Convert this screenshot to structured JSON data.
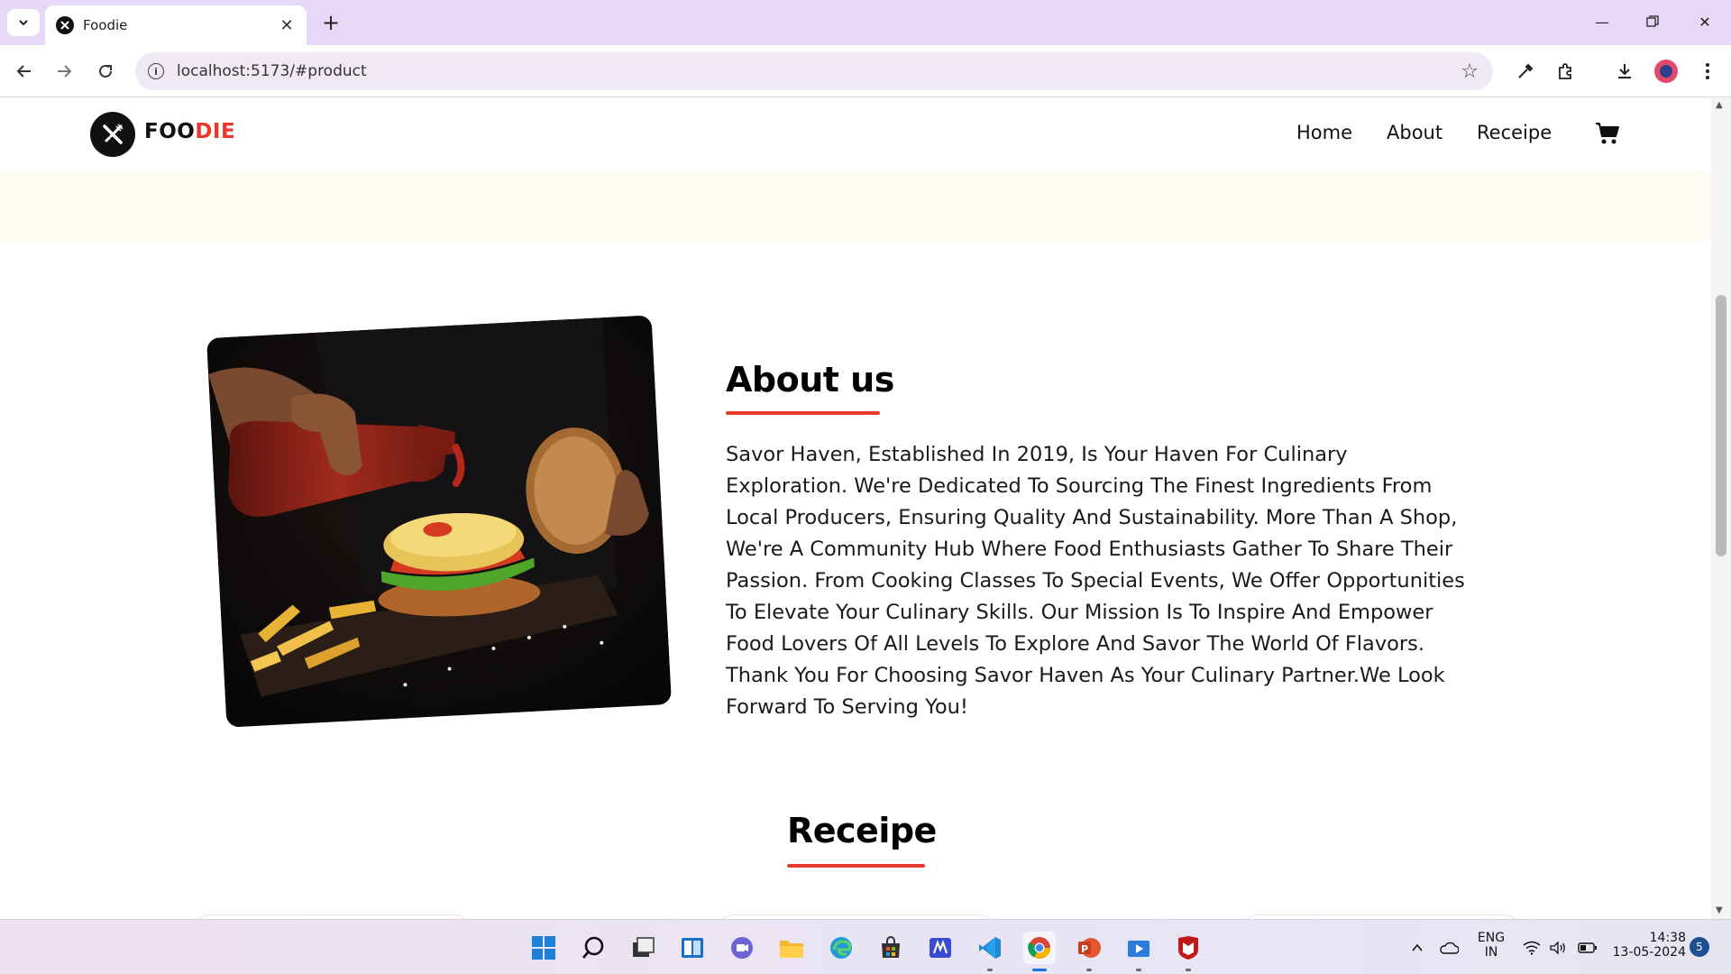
{
  "browser": {
    "tab_title": "Foodie",
    "url": "localhost:5173/#product"
  },
  "site": {
    "logo_part1": "FOO",
    "logo_part2": "DIE",
    "nav": [
      "Home",
      "About",
      "Receipe"
    ],
    "brand_color": "#e8392c",
    "hero_bg": "#fffbf3"
  },
  "about": {
    "title": "About us",
    "body": "Savor Haven, Established In 2019, Is Your Haven For Culinary Exploration. We're Dedicated To Sourcing The Finest Ingredients From Local Producers, Ensuring Quality And Sustainability. More Than A Shop, We're A Community Hub Where Food Enthusiasts Gather To Share Their Passion. From Cooking Classes To Special Events, We Offer Opportunities To Elevate Your Culinary Skills. Our Mission Is To Inspire And Empower Food Lovers Of All Levels To Explore And Savor The World Of Flavors. Thank You For Choosing Savor Haven As Your Culinary Partner.We Look Forward To Serving You!"
  },
  "recipe": {
    "title": "Receipe"
  },
  "taskbar": {
    "lang_top": "ENG",
    "lang_bottom": "IN",
    "time": "14:38",
    "date": "13-05-2024",
    "notifications": "5"
  }
}
